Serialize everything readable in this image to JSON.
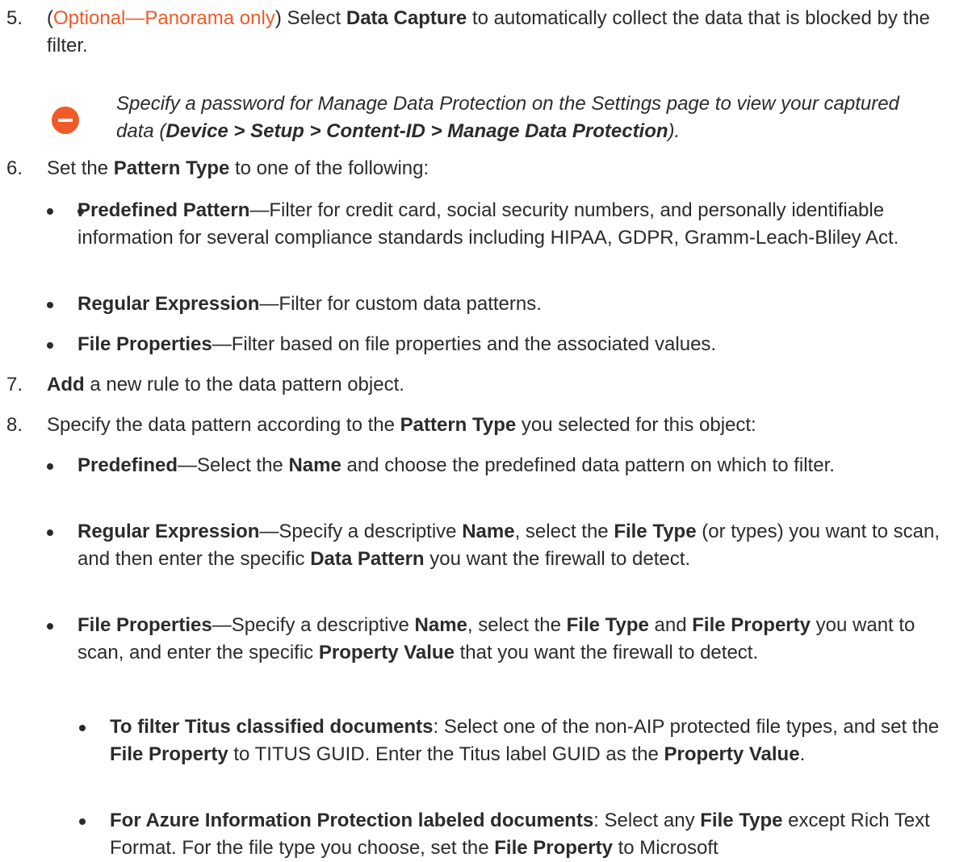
{
  "step5": {
    "number": "5.",
    "open_paren": "(",
    "optional": "Optional—Panorama only",
    "close_paren": ") Select ",
    "bold": "Data Capture",
    "rest": " to automatically collect the data that is blocked by the filter."
  },
  "note": {
    "icon": "minus-circle-icon",
    "t1": "Specify a password for Manage Data Protection on the Settings page to view your captured data (",
    "b1": "Device",
    "s1": " > ",
    "b2": "Setup",
    "s2": " > ",
    "b3": "Content-ID",
    "s3": " > ",
    "b4": "Manage Data Protection",
    "t2": ")."
  },
  "step6": {
    "number": "6.",
    "t1": "Set the ",
    "b1": "Pattern Type",
    "t2": " to one of the following:",
    "bullets": [
      {
        "bold": "Predefined Pattern",
        "text": "—Filter for credit card, social security numbers, and personally identifiable information for several compliance standards including HIPAA, GDPR, Gramm-Leach-Bliley Act."
      },
      {
        "bold": "Regular Expression",
        "text": "—Filter for custom data patterns."
      },
      {
        "bold": "File Properties",
        "text": "—Filter based on file properties and the associated values."
      }
    ]
  },
  "step7": {
    "number": "7.",
    "bold": "Add",
    "text": " a new rule to the data pattern object."
  },
  "step8": {
    "number": "8.",
    "t1": "Specify the data pattern according to the ",
    "b1": "Pattern Type",
    "t2": " you selected for this object:",
    "predefined": {
      "b1": "Predefined",
      "t1": "—Select the ",
      "b2": "Name",
      "t2": " and choose the predefined data pattern on which to filter."
    },
    "regex": {
      "b1": "Regular Expression",
      "t1": "—Specify a descriptive ",
      "b2": "Name",
      "t2": ", select the ",
      "b3": "File Type",
      "t3": " (or types) you want to scan, and then enter the specific ",
      "b4": "Data Pattern",
      "t4": " you want the firewall to detect."
    },
    "fileprops": {
      "b1": "File Properties",
      "t1": "—Specify a descriptive ",
      "b2": "Name",
      "t2": ", select the ",
      "b3": "File Type",
      "t3": " and ",
      "b4": "File Property",
      "t4": " you want to scan, and enter the specific ",
      "b5": "Property Value",
      "t5": " that you want the firewall to detect."
    },
    "titus": {
      "b1": "To filter Titus classified documents",
      "t1": ": Select one of the non-AIP protected file types, and set the ",
      "b2": "File Property",
      "t2": " to TITUS GUID. Enter the Titus label GUID as the ",
      "b3": "Property Value",
      "t3": "."
    },
    "azure": {
      "b1": "For Azure Information Protection labeled documents",
      "t1": ": Select any ",
      "b2": "File Type",
      "t2": " except Rich Text Format. For the file type you choose, set the ",
      "b3": "File Property",
      "t3": " to Microsoft"
    }
  }
}
